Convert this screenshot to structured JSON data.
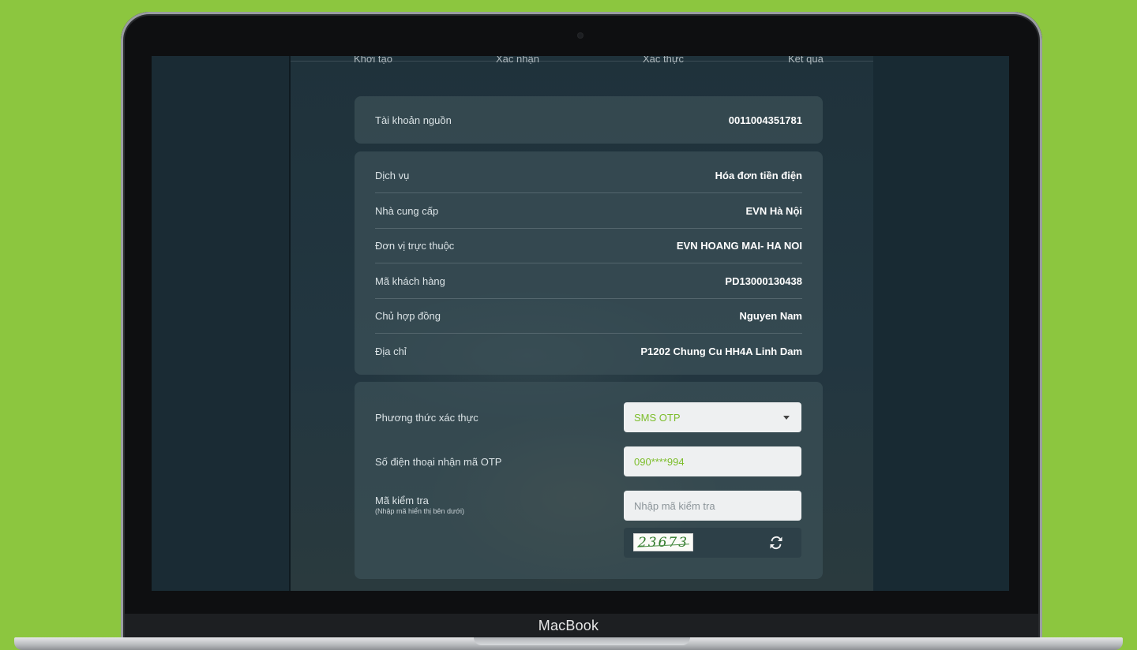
{
  "device": {
    "brand_label": "MacBook"
  },
  "steps": [
    "Khởi tạo",
    "Xác nhận",
    "Xác thực",
    "Kết quả"
  ],
  "source_account": {
    "label": "Tài khoản nguồn",
    "value": "0011004351781"
  },
  "bill_details": [
    {
      "label": "Dịch vụ",
      "value": "Hóa đơn tiền điện"
    },
    {
      "label": "Nhà cung cấp",
      "value": "EVN Hà Nội"
    },
    {
      "label": "Đơn vị trực thuộc",
      "value": "EVN HOANG MAI- HA NOI"
    },
    {
      "label": "Mã khách hàng",
      "value": "PD13000130438"
    },
    {
      "label": "Chủ hợp đồng",
      "value": "Nguyen Nam"
    },
    {
      "label": "Địa chỉ",
      "value": "P1202 Chung Cu HH4A Linh Dam"
    }
  ],
  "auth": {
    "method_label": "Phương thức xác thực",
    "method_value": "SMS OTP",
    "phone_label": "Số điện thoại nhận mã OTP",
    "phone_value": "090****994",
    "captcha_label": "Mã kiểm tra",
    "captcha_hint": "(Nhập mã hiển thị bên dưới)",
    "captcha_placeholder": "Nhập mã kiểm tra",
    "captcha_text": "23673"
  },
  "colors": {
    "background": "#8cc63f",
    "accent_green": "#7cbd2a",
    "card": "#3c5058"
  }
}
